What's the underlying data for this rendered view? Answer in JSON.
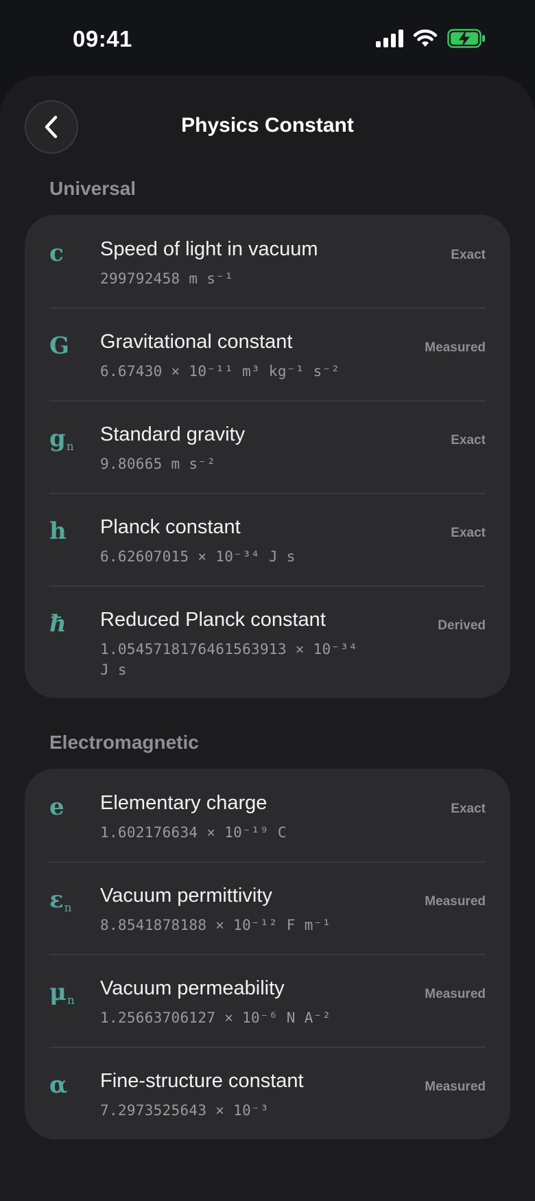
{
  "status": {
    "time": "09:41"
  },
  "header": {
    "title": "Physics Constant"
  },
  "sections": [
    {
      "title": "Universal",
      "items": [
        {
          "symbol": "c",
          "sub": "",
          "italic": false,
          "name": "Speed of light in vacuum",
          "value": "299792458 m s⁻¹",
          "status": "Exact"
        },
        {
          "symbol": "G",
          "sub": "",
          "italic": false,
          "name": "Gravitational constant",
          "value": "6.67430 × 10⁻¹¹ m³ kg⁻¹ s⁻²",
          "status": "Measured"
        },
        {
          "symbol": "g",
          "sub": "n",
          "italic": false,
          "name": "Standard gravity",
          "value": "9.80665 m s⁻²",
          "status": "Exact"
        },
        {
          "symbol": "h",
          "sub": "",
          "italic": false,
          "name": "Planck constant",
          "value": "6.62607015 × 10⁻³⁴ J s",
          "status": "Exact"
        },
        {
          "symbol": "ħ",
          "sub": "",
          "italic": true,
          "name": "Reduced Planck constant",
          "value": "1.054571817646156391​3 × 10⁻³⁴ J s",
          "status": "Derived"
        }
      ]
    },
    {
      "title": "Electromagnetic",
      "items": [
        {
          "symbol": "e",
          "sub": "",
          "italic": false,
          "name": "Elementary charge",
          "value": "1.602176634 × 10⁻¹⁹ C",
          "status": "Exact"
        },
        {
          "symbol": "ε",
          "sub": "n",
          "italic": false,
          "name": "Vacuum permittivity",
          "value": "8.8541878188 × 10⁻¹² F m⁻¹",
          "status": "Measured"
        },
        {
          "symbol": "μ",
          "sub": "n",
          "italic": false,
          "name": "Vacuum permeability",
          "value": "1.25663706127 × 10⁻⁶ N A⁻²",
          "status": "Measured"
        },
        {
          "symbol": "α",
          "sub": "",
          "italic": false,
          "name": "Fine-structure constant",
          "value": "7.2973525643 × 10⁻³",
          "status": "Measured"
        }
      ]
    }
  ],
  "colors": {
    "accent": "#55a89c",
    "battery": "#34c759"
  }
}
